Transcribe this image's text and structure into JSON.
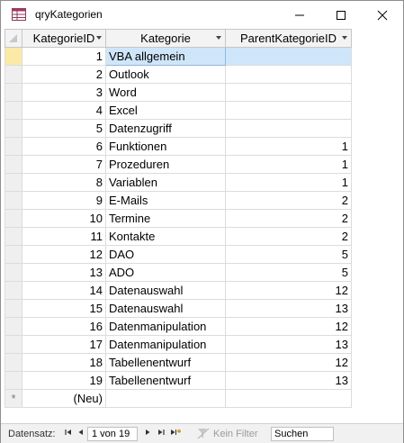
{
  "window": {
    "title": "qryKategorien"
  },
  "columns": [
    {
      "label": "KategorieID"
    },
    {
      "label": "Kategorie"
    },
    {
      "label": "ParentKategorieID"
    }
  ],
  "rows": [
    {
      "id": "1",
      "kategorie": "VBA allgemein",
      "parent": ""
    },
    {
      "id": "2",
      "kategorie": "Outlook",
      "parent": ""
    },
    {
      "id": "3",
      "kategorie": "Word",
      "parent": ""
    },
    {
      "id": "4",
      "kategorie": "Excel",
      "parent": ""
    },
    {
      "id": "5",
      "kategorie": "Datenzugriff",
      "parent": ""
    },
    {
      "id": "6",
      "kategorie": "Funktionen",
      "parent": "1"
    },
    {
      "id": "7",
      "kategorie": "Prozeduren",
      "parent": "1"
    },
    {
      "id": "8",
      "kategorie": "Variablen",
      "parent": "1"
    },
    {
      "id": "9",
      "kategorie": "E-Mails",
      "parent": "2"
    },
    {
      "id": "10",
      "kategorie": "Termine",
      "parent": "2"
    },
    {
      "id": "11",
      "kategorie": "Kontakte",
      "parent": "2"
    },
    {
      "id": "12",
      "kategorie": "DAO",
      "parent": "5"
    },
    {
      "id": "13",
      "kategorie": "ADO",
      "parent": "5"
    },
    {
      "id": "14",
      "kategorie": "Datenauswahl",
      "parent": "12"
    },
    {
      "id": "15",
      "kategorie": "Datenauswahl",
      "parent": "13"
    },
    {
      "id": "16",
      "kategorie": "Datenmanipulation",
      "parent": "12"
    },
    {
      "id": "17",
      "kategorie": "Datenmanipulation",
      "parent": "13"
    },
    {
      "id": "18",
      "kategorie": "Tabellenentwurf",
      "parent": "12"
    },
    {
      "id": "19",
      "kategorie": "Tabellenentwurf",
      "parent": "13"
    }
  ],
  "new_row": {
    "marker": "*",
    "id_placeholder": "(Neu)"
  },
  "navigation": {
    "label": "Datensatz:",
    "record_position": "1 von 19",
    "filter_label": "Kein Filter",
    "search_placeholder": "Suchen"
  },
  "colors": {
    "selection": "#cfe6fa",
    "header": "#f3f3f3",
    "gridline": "#dcdcdc"
  },
  "icons": {
    "app": "query-table-icon",
    "minimize": "minimize-icon",
    "maximize": "maximize-icon",
    "close": "close-icon",
    "first": "first-record-icon",
    "prev": "previous-record-icon",
    "next": "next-record-icon",
    "last": "last-record-icon",
    "new": "new-record-icon",
    "filter": "filter-icon"
  }
}
